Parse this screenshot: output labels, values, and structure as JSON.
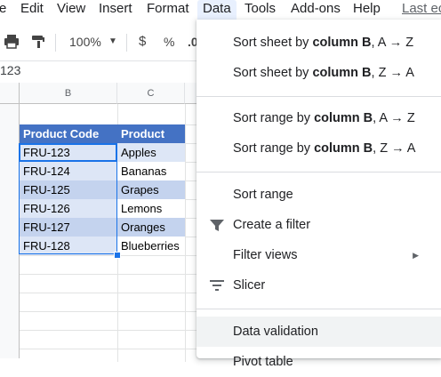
{
  "menubar": {
    "items": [
      "e",
      "Edit",
      "View",
      "Insert",
      "Format",
      "Data",
      "Tools",
      "Add-ons",
      "Help",
      "Last ec"
    ]
  },
  "toolbar": {
    "zoom": "100%",
    "currency": "$",
    "percent": "%",
    "decimal": ".0"
  },
  "formula_bar": {
    "name_box": "123"
  },
  "sheet": {
    "columns": [
      "B",
      "C"
    ],
    "headers": [
      "Product Code",
      "Product"
    ],
    "rows": [
      [
        "FRU-123",
        "Apples"
      ],
      [
        "FRU-124",
        "Bananas"
      ],
      [
        "FRU-125",
        "Grapes"
      ],
      [
        "FRU-126",
        "Lemons"
      ],
      [
        "FRU-127",
        "Oranges"
      ],
      [
        "FRU-128",
        "Blueberries"
      ]
    ]
  },
  "data_menu": {
    "sort_sheet_az": {
      "prefix": "Sort sheet by ",
      "bold": "column B",
      "suffix": ", A → Z"
    },
    "sort_sheet_za": {
      "prefix": "Sort sheet by ",
      "bold": "column B",
      "suffix": ", Z → A"
    },
    "sort_range_az": {
      "prefix": "Sort range by ",
      "bold": "column B",
      "suffix": ", A → Z"
    },
    "sort_range_za": {
      "prefix": "Sort range by ",
      "bold": "column B",
      "suffix": ", Z → A"
    },
    "sort_range": "Sort range",
    "create_filter": "Create a filter",
    "filter_views": "Filter views",
    "slicer": "Slicer",
    "data_validation": "Data validation",
    "pivot_table": "Pivot table"
  },
  "colors": {
    "accent": "#1a73e8",
    "table_header": "#4472c4",
    "band_light": "#dde6f6",
    "band_dark": "#c4d3ee",
    "menu_active": "#e8f0fe"
  }
}
